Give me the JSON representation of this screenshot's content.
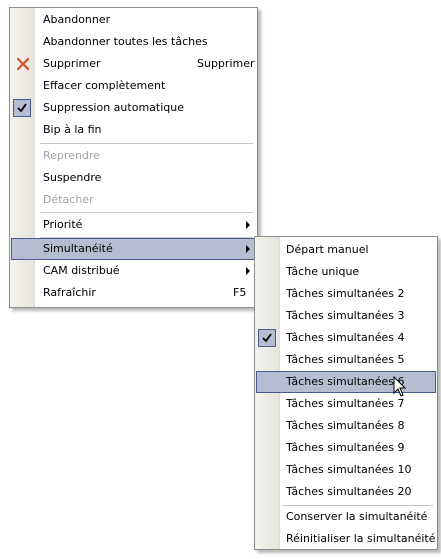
{
  "main_menu": {
    "abandon": "Abandonner",
    "abandon_all": "Abandonner toutes les tâches",
    "delete": "Supprimer",
    "delete_shortcut": "Supprimer",
    "erase_completely": "Effacer complètement",
    "auto_delete": "Suppression automatique",
    "beep_at_end": "Bip à la fin",
    "resume": "Reprendre",
    "suspend": "Suspendre",
    "detach": "Détacher",
    "priority": "Priorité",
    "simultaneity": "Simultanéité",
    "distributed_cam": "CAM distribué",
    "refresh": "Rafraîchir",
    "refresh_shortcut": "F5"
  },
  "submenu": {
    "manual_start": "Départ manuel",
    "single_task": "Tâche unique",
    "tasks_2": "Tâches simultanées 2",
    "tasks_3": "Tâches simultanées 3",
    "tasks_4": "Tâches simultanées 4",
    "tasks_5": "Tâches simultanées 5",
    "tasks_6": "Tâches simultanées 6",
    "tasks_7": "Tâches simultanées 7",
    "tasks_8": "Tâches simultanées 8",
    "tasks_9": "Tâches simultanées 9",
    "tasks_10": "Tâches simultanées 10",
    "tasks_20": "Tâches simultanées 20",
    "keep_simultaneity": "Conserver la simultanéité",
    "reset_simultaneity": "Réinitialiser la simultanéité"
  },
  "colors": {
    "highlight": "#b6bdd2",
    "highlight_border": "#4a5a8a",
    "delete_icon": "#d9502d",
    "disabled_text": "#a3a3a3"
  }
}
